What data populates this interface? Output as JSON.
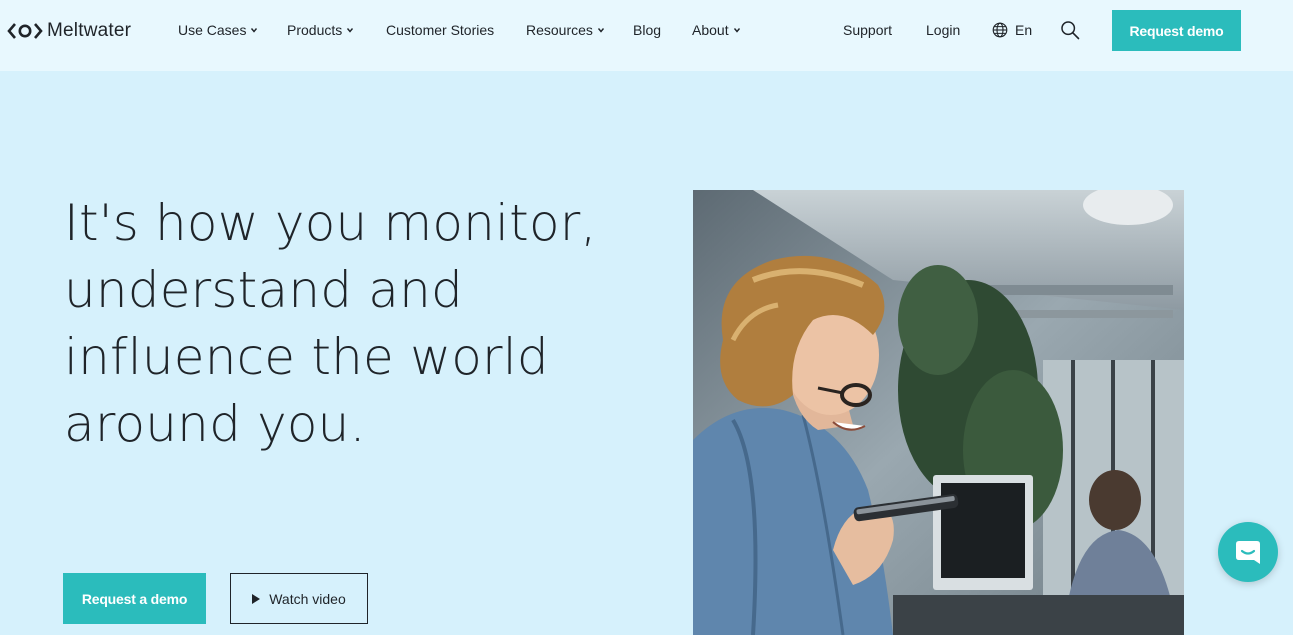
{
  "brand": {
    "name": "Meltwater",
    "accent_color": "#2bbcbc",
    "background_color": "#d6f1fc",
    "header_color": "#e8f8fe",
    "text_color": "#1f2429"
  },
  "nav": {
    "items": [
      {
        "label": "Use Cases",
        "has_dropdown": true
      },
      {
        "label": "Products",
        "has_dropdown": true
      },
      {
        "label": "Customer Stories",
        "has_dropdown": false
      },
      {
        "label": "Resources",
        "has_dropdown": true
      },
      {
        "label": "Blog",
        "has_dropdown": false
      },
      {
        "label": "About",
        "has_dropdown": true
      }
    ],
    "support": "Support",
    "login": "Login",
    "language": "En",
    "cta": "Request demo"
  },
  "hero": {
    "headline": "It's how you monitor, understand and influence the world around you.",
    "primary_cta": "Request a demo",
    "secondary_cta": "Watch video",
    "photo_icon": "photo-woman-with-phone"
  },
  "chat": {
    "icon": "chat-icon"
  }
}
